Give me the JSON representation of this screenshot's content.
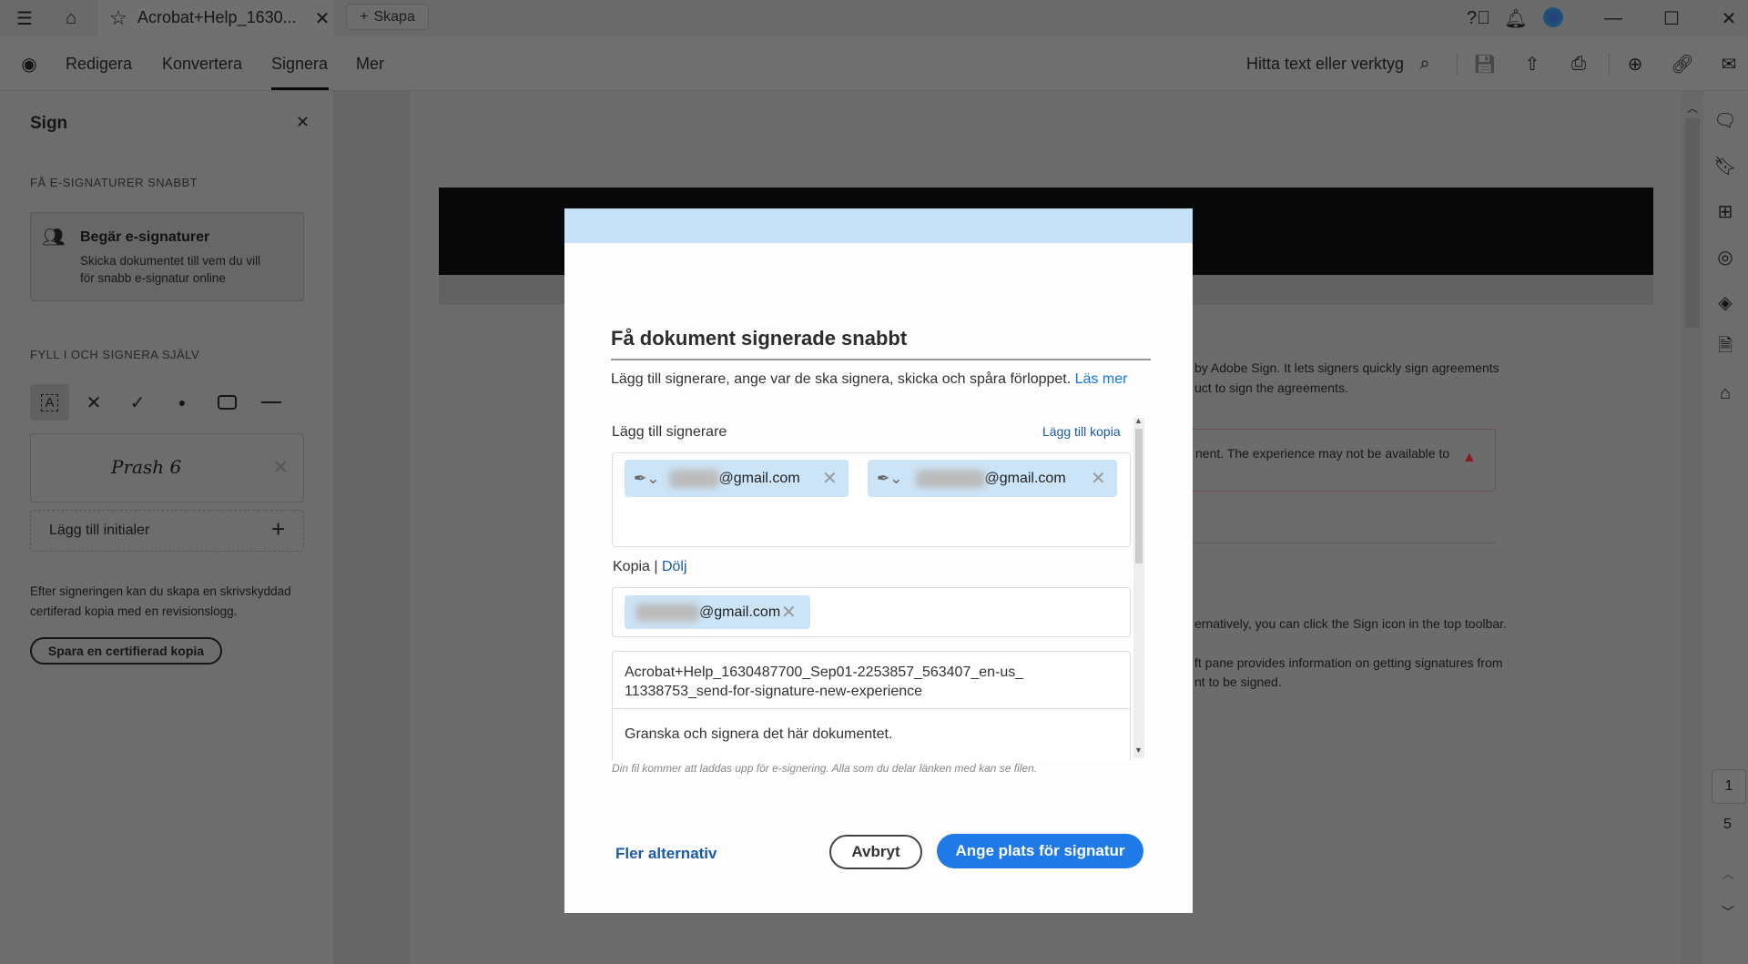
{
  "titlebar": {
    "tab_title": "Acrobat+Help_1630...",
    "new_button": "Skapa"
  },
  "toolbar": {
    "tabs": [
      "Redigera",
      "Konvertera",
      "Signera",
      "Mer"
    ],
    "active_tab": "Signera",
    "search_label": "Hitta text eller verktyg"
  },
  "left_panel": {
    "title": "Sign",
    "section1": "FÅ E-SIGNATURER SNABBT",
    "card_title": "Begär e-signaturer",
    "card_desc_1": "Skicka dokumentet till vem du vill",
    "card_desc_2": "för snabb e-signatur online",
    "section2": "FYLL I OCH SIGNERA SJÄLV",
    "signature": "Prash 6",
    "add_initials": "Lägg till initialer",
    "info_1": "Efter signeringen kan du skapa en skrivskyddad",
    "info_2": "certiferad kopia med en revisionslogg.",
    "save_certified": "Spara en certifierad kopia"
  },
  "document": {
    "line1": "by Adobe Sign. It lets signers quickly sign agreements",
    "line2": "uct to sign the agreements.",
    "warning": "nent. The experience may not be available to",
    "line3": "ernatively, you can click the Sign icon in the top toolbar.",
    "line4": "ft pane provides information on getting signatures from",
    "line5": "nt to be signed.",
    "warning_color": "#c0272d"
  },
  "page_nav": {
    "current": "1",
    "total": "5"
  },
  "dialog": {
    "title": "Få dokument signerade snabbt",
    "description": "Lägg till signerare, ange var de ska signera, skicka och spåra förloppet.",
    "learn_more": "Läs mer",
    "signers_label": "Lägg till signerare",
    "add_copy": "Lägg till kopia",
    "signers": [
      {
        "email": "@gmail.com"
      },
      {
        "email": "@gmail.com"
      }
    ],
    "copy_label": "Kopia",
    "hide": "Dölj",
    "cc": [
      {
        "email": "@gmail.com"
      }
    ],
    "doc_name": "Acrobat+Help_1630487700_Sep01-2253857_563407_en-us_11338753_send-for-signature-new-experience",
    "message": "Granska och signera det här dokumentet.",
    "note": "Din fil kommer att laddas upp för e-signering. Alla som du delar länken med kan se filen.",
    "more_options": "Fler alternativ",
    "cancel": "Avbryt",
    "primary": "Ange plats för signatur",
    "accent": "#1473e6"
  }
}
